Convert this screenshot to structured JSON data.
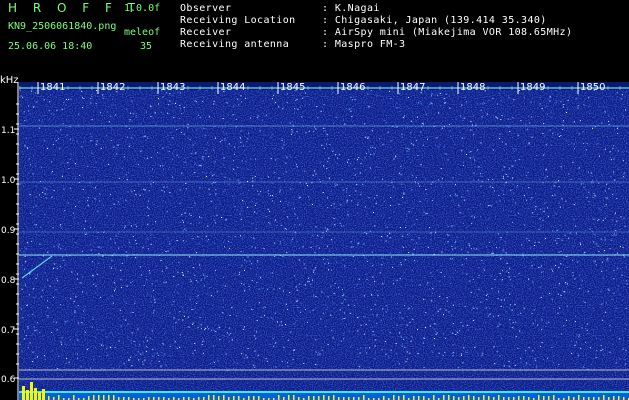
{
  "header": {
    "title": "H R O F F T",
    "version": "1.0.0f",
    "filename": "KN9_2506061840.png",
    "meleof_label": "meleof",
    "datetime": "25.06.06 18:40",
    "count": "35"
  },
  "info": [
    {
      "label": "Observer",
      "value": "K.Nagai"
    },
    {
      "label": "Receiving Location",
      "value": "Chigasaki, Japan (139.414 35.340)"
    },
    {
      "label": "Receiver",
      "value": "AirSpy mini (Miakejima VOR 108.65MHz)"
    },
    {
      "label": "Receiving antenna",
      "value": "Maspro FM-3"
    }
  ],
  "y_axis": {
    "unit": "kHz",
    "ticks": [
      "1.1",
      "1.0",
      "0.9",
      "0.8",
      "0.7",
      "0.6"
    ]
  },
  "time_labels": [
    "1841",
    "1842",
    "1843",
    "1844",
    "1845",
    "1846",
    "1847",
    "1848",
    "1849",
    "1850"
  ],
  "colors": {
    "background": "#000000",
    "noise_base": "#0b1c8c",
    "header_green": "#78ff78",
    "trace": "#5ff0ff",
    "bottom_bar": "#f6f600"
  }
}
